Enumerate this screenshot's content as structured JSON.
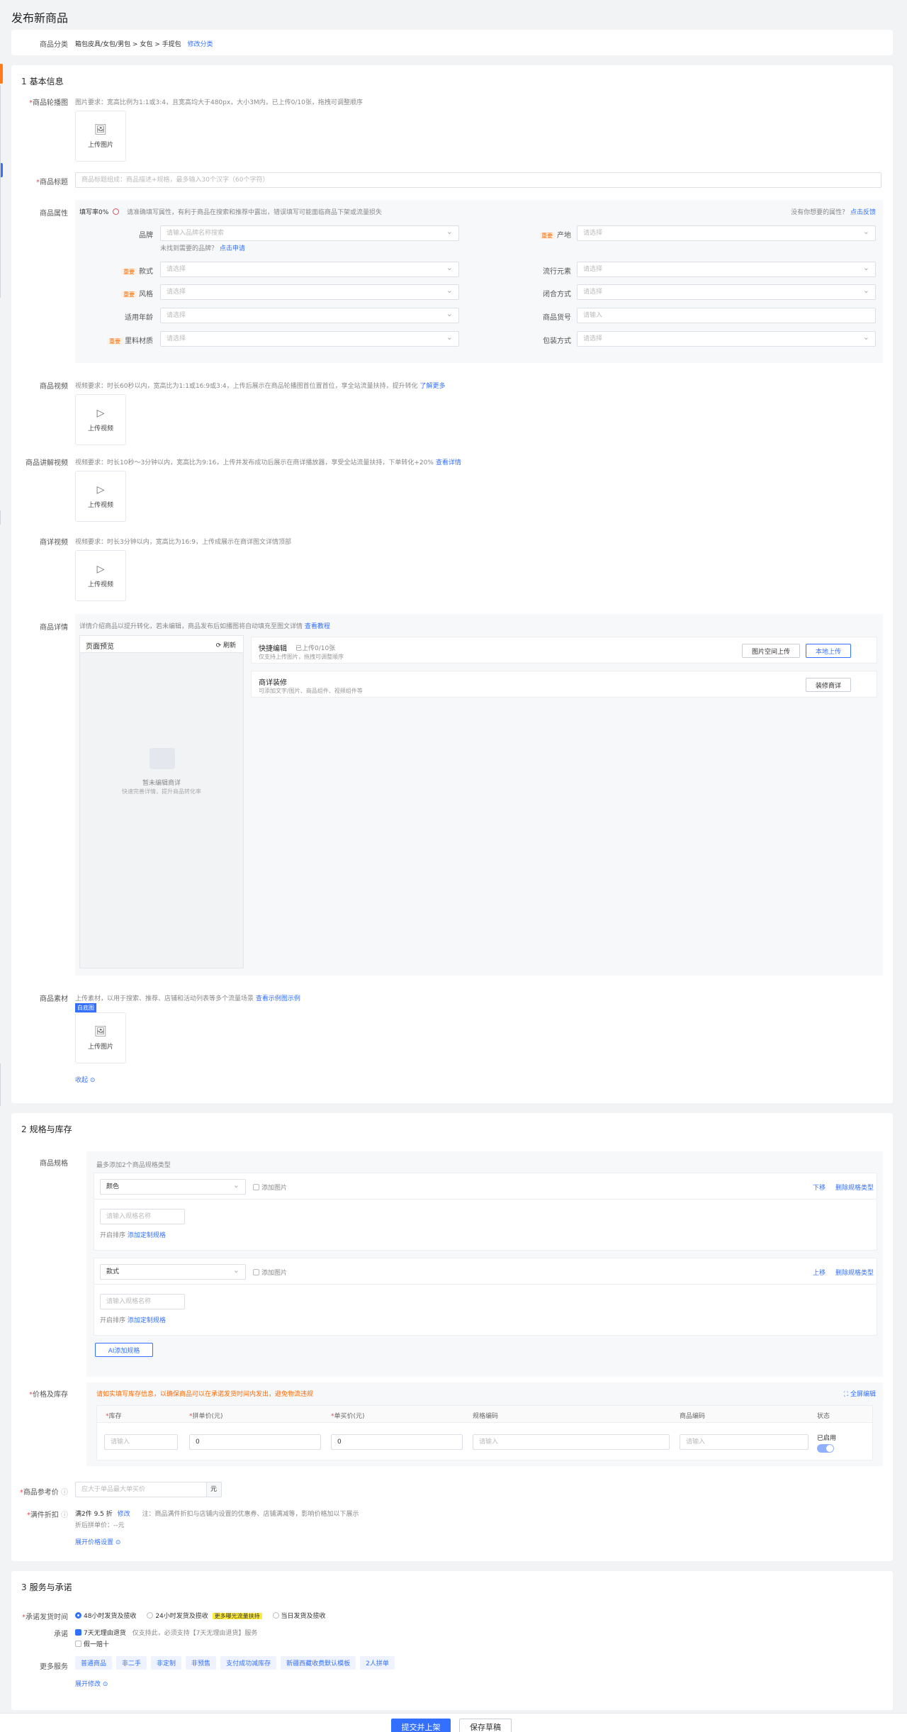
{
  "page": {
    "title": "发布新商品"
  },
  "category": {
    "label": "商品分类",
    "path": "箱包皮具/女包/男包 > 女包 > 手提包",
    "edit": "修改分类"
  },
  "basic": {
    "title_num": "1",
    "title": "基本信息",
    "main_img": {
      "label": "商品轮播图",
      "hint": "图片要求：宽高比例为1:1或3:4，且宽高均大于480px，大小3M内，已上传0/10张，拖拽可调整顺序",
      "upload": "上传图片"
    },
    "goods_title": {
      "label": "商品标题",
      "placeholder": "商品标题组成：商品描述+规格，最多输入30个汉字（60个字符）"
    },
    "attrs": {
      "label": "商品属性",
      "rate": "填写率0%",
      "hint": "请准确填写属性，有利于商品在搜索和推荐中露出，错误填写可能面临商品下架或流量损失",
      "missing": "没有你想要的属性？",
      "feedback": "点击反馈",
      "brand_label": "品牌",
      "brand_ph": "请输入品牌名称搜索",
      "brand_tip": "未找到需要的品牌？",
      "brand_apply": "点击申请",
      "origin_label": "产地",
      "select_ph": "请选择",
      "input_ph": "请输入",
      "style_label": "款式",
      "popular_label": "流行元素",
      "feng_label": "风格",
      "close_label": "闭合方式",
      "age_label": "适用年龄",
      "code_label": "商品货号",
      "material_label": "里料材质",
      "pack_label": "包装方式",
      "important": "重要"
    },
    "video": {
      "label": "商品视频",
      "hint": "视频要求：时长60秒以内，宽高比为1:1或16:9或3:4，上传后展示在商品轮播图首位置首位，享全站流量扶持，提升转化",
      "more": "了解更多",
      "upload": "上传视频"
    },
    "explain": {
      "label": "商品讲解视频",
      "hint": "视频要求：时长10秒～3分钟以内，宽高比为9:16，上传并发布成功后展示在商详播放器，享受全站流量扶持，下单转化+20%",
      "more": "查看详情",
      "upload": "上传视频"
    },
    "detail_video": {
      "label": "商详视频",
      "hint": "视频要求：时长3分钟以内，宽高比为16:9，上传成展示在商详图文详情顶部",
      "upload": "上传视频"
    },
    "detail": {
      "label": "商品详情",
      "hint": "详情介绍商品以提升转化，若未编辑，商品发布后如播图将自动填充至图文详情",
      "more": "查看教程",
      "preview_title": "页面预览",
      "refresh": "刷新",
      "empty_title": "暂未编辑商详",
      "empty_sub": "快速完善详情，提升商品转化率",
      "quick_title": "快捷编辑",
      "quick_count": "已上传0/10张",
      "quick_sub": "仅支持上传图片，拖拽可调整顺序",
      "space_upload": "图片空间上传",
      "local_upload": "本地上传",
      "deco_title": "商详装修",
      "deco_sub": "可添加文字/图片、商品组件、视频组件等",
      "deco_btn": "装修商详"
    },
    "material": {
      "label": "商品素材",
      "hint": "上传素材，以用于搜索、推荐、店铺和活动列表等多个流量场景",
      "more": "查看示例图示例",
      "tag": "白底图",
      "upload": "上传图片",
      "collapse": "收起"
    }
  },
  "spec": {
    "title_num": "2",
    "title": "规格与库存",
    "spec_label": "商品规格",
    "spec_hint": "最多添加2个商品规格类型",
    "spec1": {
      "name": "颜色",
      "add_img": "添加图片",
      "down": "下移",
      "del": "删除规格类型",
      "ph": "请输入规格名称",
      "batch": "开启排序",
      "custom": "添加定制规格"
    },
    "spec2": {
      "name": "款式",
      "add_img": "添加图片",
      "up": "上移",
      "del": "删除规格类型",
      "ph": "请输入规格名称",
      "batch": "开启排序",
      "custom": "添加定制规格"
    },
    "add_spec": "AI添加规格",
    "price_label": "价格及库存",
    "price_warn": "请如实填写库存信息，以确保商品可以在承诺发货时间内发出，避免物流违规",
    "fullscreen": "全屏编辑",
    "cols": [
      "库存",
      "拼单价(元)",
      "单买价(元)",
      "规格编码",
      "商品编码",
      "状态"
    ],
    "row": {
      "stock_ph": "请输入",
      "group_price": "0",
      "single_price": "0",
      "spec_code_ph": "请输入",
      "goods_code_ph": "请输入",
      "status": "已启用"
    },
    "ref_price_label": "商品参考价",
    "ref_price_ph": "应大于单品最大单买价",
    "ref_unit": "元",
    "discount_label": "满件折扣",
    "discount_val": "满2件 9.5 折",
    "discount_edit": "修改",
    "discount_note": "注：商品满件折扣与店铺内设置的优惠券、店铺满减等，影响价格加以下展示",
    "discount_price": "折后拼单价：--元",
    "expand_price": "展开价格设置"
  },
  "service": {
    "title_num": "3",
    "title": "服务与承诺",
    "ship_label": "承诺发货时间",
    "opt48": "48小时发货及揽收",
    "opt24": "24小时发货及揽收",
    "hot_tag": "更多曝光流量扶持",
    "opt_today": "当日发货及揽收",
    "promise_label": "承诺",
    "promise1": "7天无理由退货",
    "promise1_note": "仅支持此，必须支持【7天无理由退货】服务",
    "promise2": "假一赔十",
    "more_label": "更多服务",
    "chips": [
      "普通商品",
      "非二手",
      "非定制",
      "非预售",
      "支付成功减库存",
      "新疆西藏收费默认模板",
      "2人拼单"
    ],
    "expand": "展开修改"
  },
  "footer": {
    "submit": "提交并上架",
    "draft": "保存草稿"
  }
}
